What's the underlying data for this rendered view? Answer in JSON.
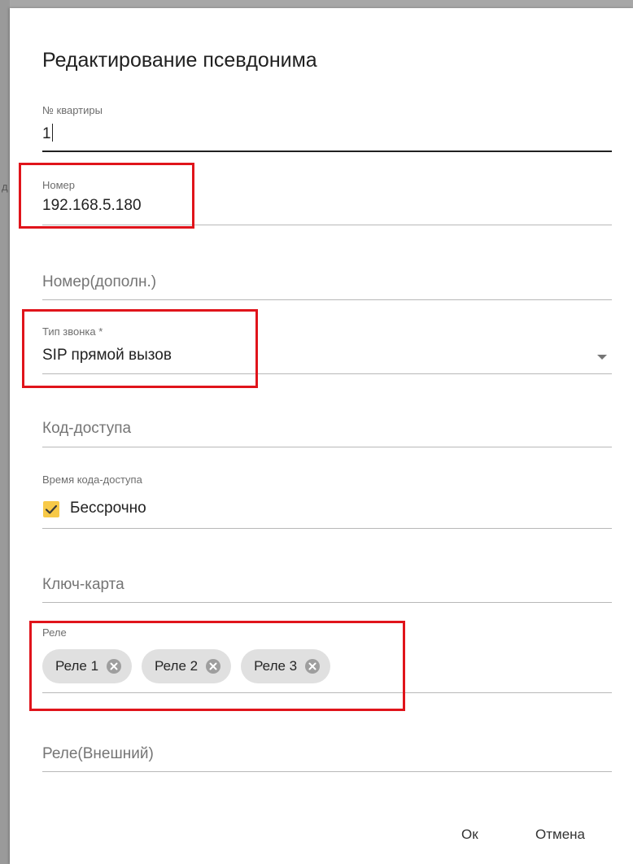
{
  "background": {
    "partial_letter": "д"
  },
  "dialog": {
    "title": "Редактирование псевдонима",
    "apartment": {
      "label": "№ квартиры",
      "value": "1"
    },
    "number": {
      "label": "Номер",
      "value": "192.168.5.180"
    },
    "number_extra": {
      "placeholder": "Номер(дополн.)"
    },
    "call_type": {
      "label": "Тип звонка *",
      "value": "SIP прямой вызов"
    },
    "access_code": {
      "placeholder": "Код-доступа"
    },
    "access_code_time": {
      "label": "Время кода-доступа",
      "checkbox_label": "Бессрочно",
      "checked": true
    },
    "key_card": {
      "placeholder": "Ключ-карта"
    },
    "relay": {
      "label": "Реле",
      "chips": [
        "Реле 1",
        "Реле 2",
        "Реле 3"
      ]
    },
    "relay_external": {
      "placeholder": "Реле(Внешний)"
    },
    "buttons": {
      "ok": "Ок",
      "cancel": "Отмена"
    }
  },
  "colors": {
    "highlight": "#e0141b",
    "checkbox": "#f7c948",
    "chip_bg": "#e0e0e0"
  }
}
